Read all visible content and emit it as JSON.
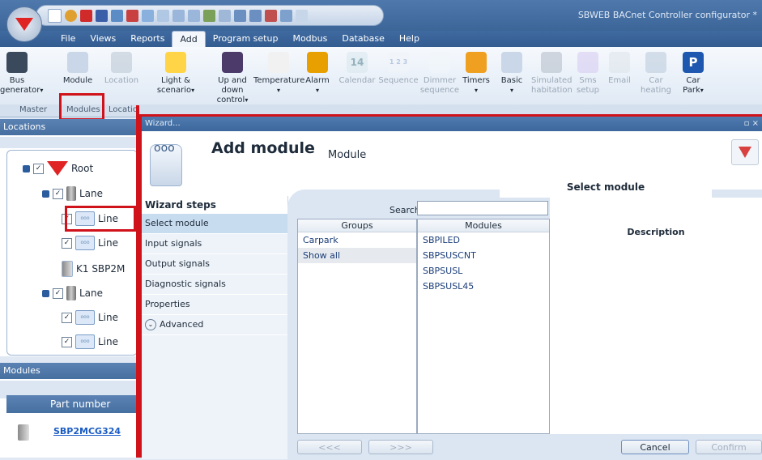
{
  "window": {
    "title": "SBWEB BACnet Controller configurator *"
  },
  "menu": {
    "tabs": [
      "File",
      "Views",
      "Reports",
      "Add",
      "Program setup",
      "Modbus",
      "Database",
      "Help"
    ],
    "active": "Add"
  },
  "ribbon": {
    "buttons": [
      {
        "label1": "Bus",
        "label2": "generator",
        "arrow": "▾",
        "disabled": false,
        "icon": "bus-generator-icon"
      },
      {
        "label1": "Module",
        "label2": "",
        "arrow": "",
        "disabled": false,
        "icon": "module-icon"
      },
      {
        "label1": "Location",
        "label2": "",
        "arrow": "",
        "disabled": true,
        "icon": "location-icon"
      },
      {
        "label1": "Light &",
        "label2": "scenario",
        "arrow": "▾",
        "disabled": false,
        "icon": "light-bulb-icon"
      },
      {
        "label1": "Up and down",
        "label2": "control",
        "arrow": "▾",
        "disabled": false,
        "icon": "up-down-control-icon"
      },
      {
        "label1": "Temperature",
        "label2": "",
        "arrow": "▾",
        "disabled": false,
        "icon": "thermometer-icon"
      },
      {
        "label1": "Alarm",
        "label2": "",
        "arrow": "▾",
        "disabled": false,
        "icon": "alarm-icon"
      },
      {
        "label1": "Calendar",
        "label2": "",
        "arrow": "",
        "disabled": true,
        "icon": "calendar-icon"
      },
      {
        "label1": "Sequence",
        "label2": "",
        "arrow": "",
        "disabled": true,
        "icon": "sequence-icon"
      },
      {
        "label1": "Dimmer",
        "label2": "sequence",
        "arrow": "",
        "disabled": true,
        "icon": "dimmer-sequence-icon"
      },
      {
        "label1": "Timers",
        "label2": "",
        "arrow": "▾",
        "disabled": false,
        "icon": "timer-icon"
      },
      {
        "label1": "Basic",
        "label2": "",
        "arrow": "▾",
        "disabled": false,
        "icon": "basic-icon"
      },
      {
        "label1": "Simulated",
        "label2": "habitation",
        "arrow": "",
        "disabled": true,
        "icon": "simulated-habitation-icon"
      },
      {
        "label1": "Sms",
        "label2": "setup",
        "arrow": "",
        "disabled": true,
        "icon": "sms-icon"
      },
      {
        "label1": "Email",
        "label2": "",
        "arrow": "",
        "disabled": true,
        "icon": "email-icon"
      },
      {
        "label1": "Car",
        "label2": "heating",
        "arrow": "",
        "disabled": true,
        "icon": "car-heating-icon"
      },
      {
        "label1": "Car",
        "label2": "Park",
        "arrow": "▾",
        "disabled": false,
        "icon": "car-park-icon"
      }
    ],
    "calendar_day": "14",
    "sequence_digits": "1 2 3",
    "groups": [
      "Master",
      "Modules",
      "Locatio"
    ]
  },
  "locations": {
    "title": "Locations",
    "tree": [
      {
        "label": "Root",
        "checked": true,
        "expander": true,
        "type": "root"
      },
      {
        "label": "Lane",
        "checked": true,
        "expander": true,
        "type": "lane"
      },
      {
        "label": "Line",
        "checked": true,
        "expander": false,
        "type": "line"
      },
      {
        "label": "Line",
        "checked": true,
        "expander": false,
        "type": "line"
      },
      {
        "label": "K1 SBP2M",
        "checked": false,
        "expander": false,
        "type": "module"
      },
      {
        "label": "Lane",
        "checked": true,
        "expander": true,
        "type": "lane"
      },
      {
        "label": "Line",
        "checked": true,
        "expander": false,
        "type": "line"
      },
      {
        "label": "Line",
        "checked": true,
        "expander": false,
        "type": "line"
      }
    ]
  },
  "modules": {
    "title": "Modules",
    "column": "Part number",
    "rows": [
      "SBP2MCG324"
    ]
  },
  "wizard": {
    "window_title": "Wizard...",
    "title": "Add module",
    "subtitle": "Module",
    "steps_title": "Wizard steps",
    "steps": [
      "Select module",
      "Input signals",
      "Output signals",
      "Diagnostic signals",
      "Properties"
    ],
    "advanced": "Advanced",
    "panel_title": "Select module",
    "search_label": "Search",
    "search_value": "",
    "groups_header": "Groups",
    "groups": [
      "Carpark",
      "Show all"
    ],
    "modules_header": "Modules",
    "modules": [
      "SBPILED",
      "SBPSUSCNT",
      "SBPSUSL",
      "SBPSUSL45"
    ],
    "description_header": "Description",
    "buttons": {
      "prev": "<<<",
      "next": ">>>",
      "cancel": "Cancel",
      "confirm": "Confirm"
    }
  }
}
